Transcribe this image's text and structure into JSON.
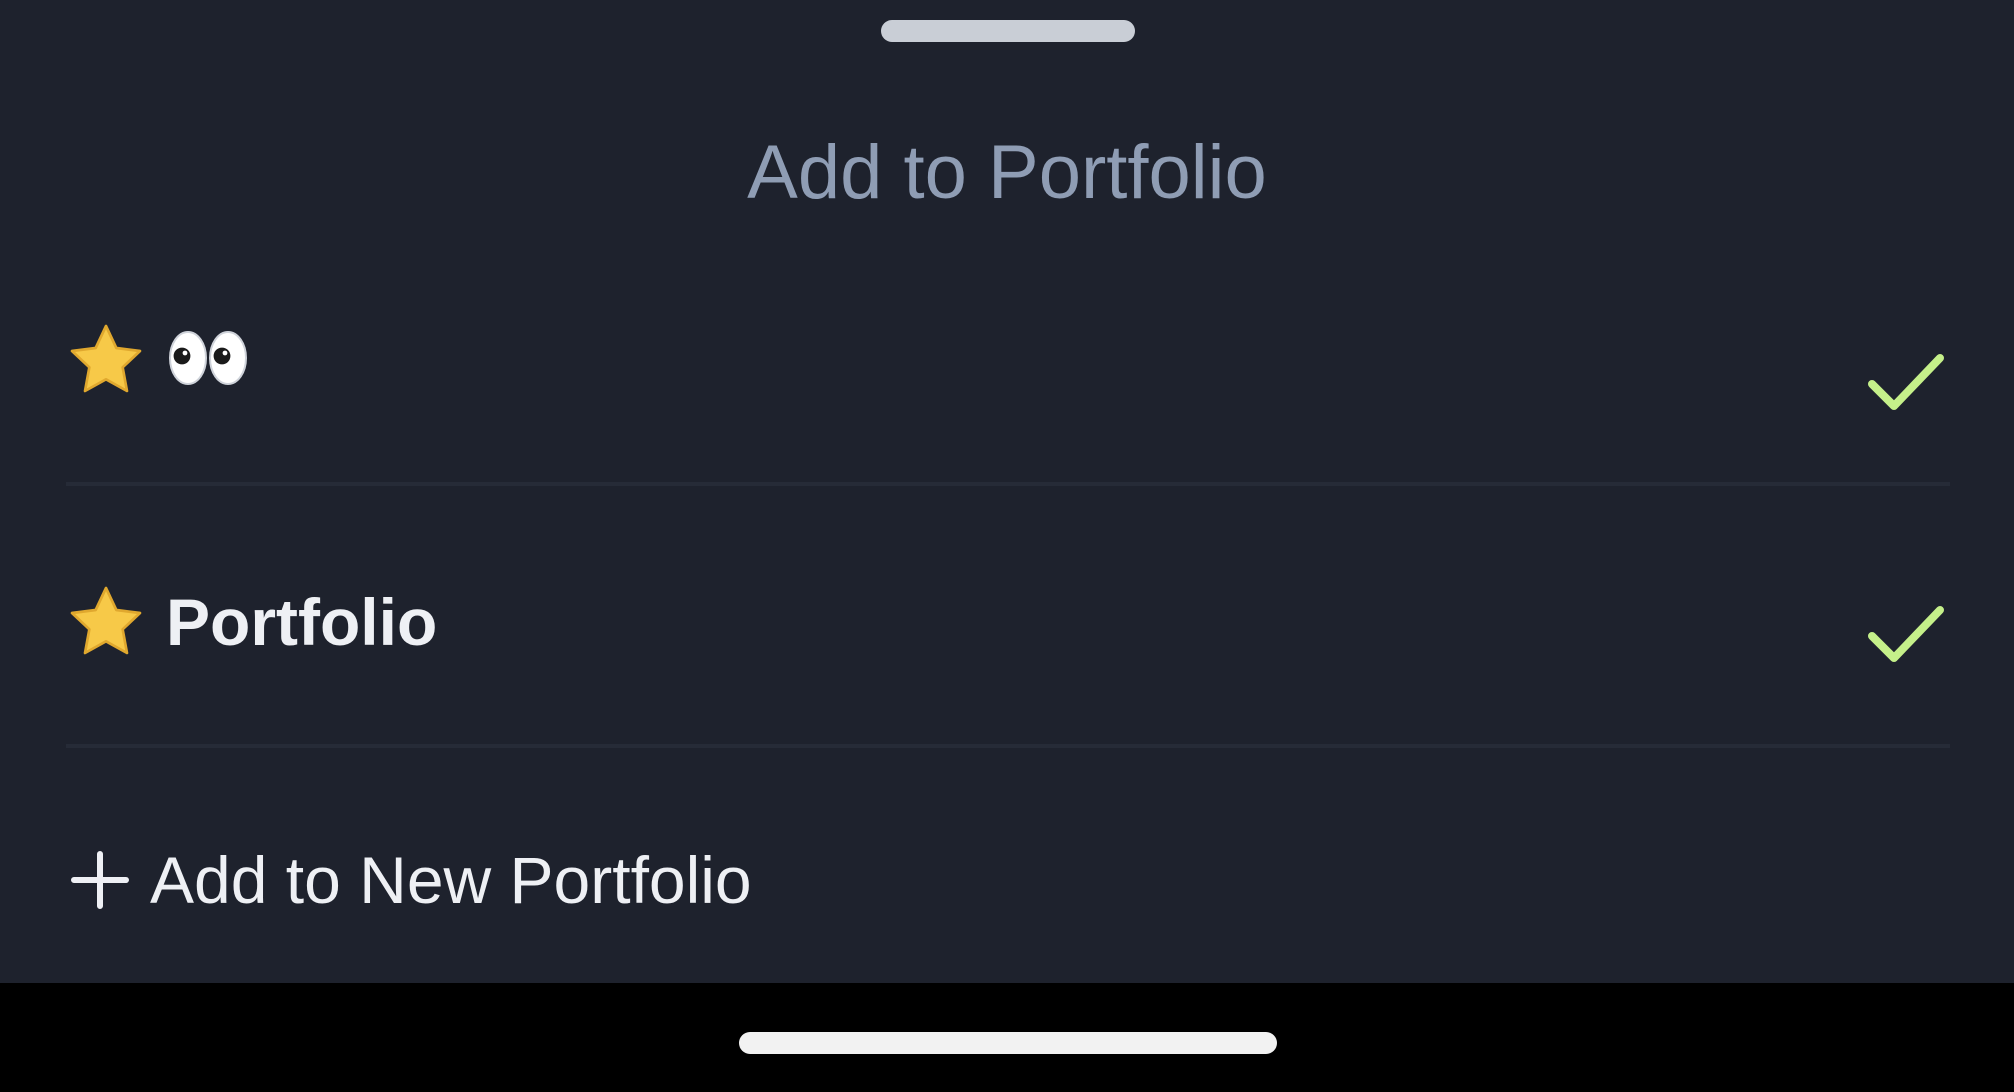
{
  "sheet": {
    "title": "Add to Portfolio",
    "background": "#1e222d",
    "title_color": "#8f9db4",
    "check_color": "#c5f08a",
    "star_color": "#f7c948"
  },
  "portfolios": [
    {
      "icon": "star-icon",
      "emoji": "eyes-emoji",
      "label": "",
      "selected": true
    },
    {
      "icon": "star-icon",
      "label": "Portfolio",
      "selected": true
    }
  ],
  "add_new": {
    "icon": "plus-icon",
    "label": "Add to New Portfolio"
  }
}
